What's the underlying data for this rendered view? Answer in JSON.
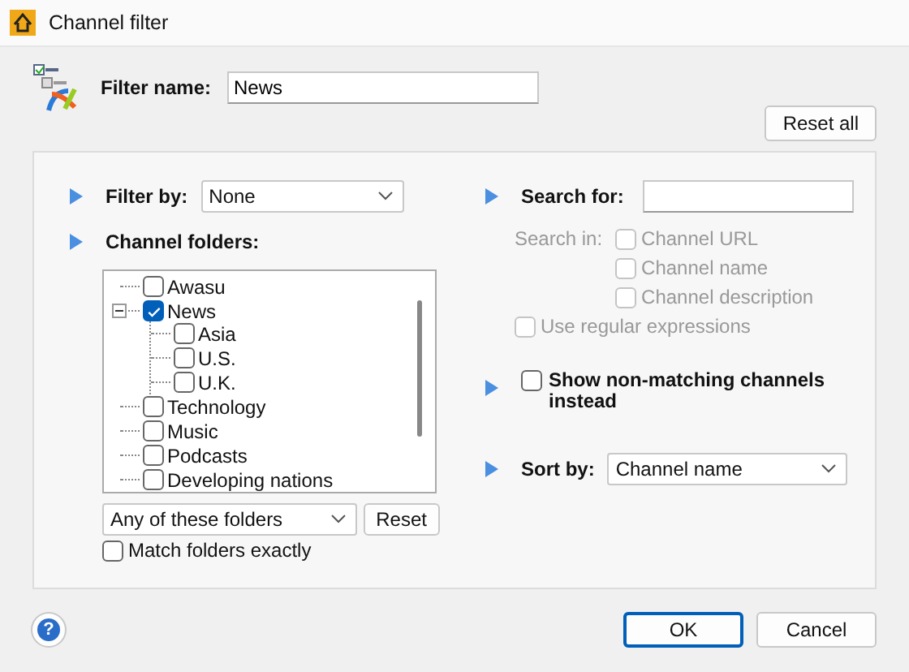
{
  "window": {
    "title": "Channel filter"
  },
  "filter_name": {
    "label": "Filter name:",
    "value": "News"
  },
  "reset_all_button": "Reset all",
  "filter_by": {
    "label": "Filter by:",
    "value": "None"
  },
  "channel_folders": {
    "label": "Channel folders:",
    "tree": [
      {
        "label": "Awasu",
        "checked": false
      },
      {
        "label": "News",
        "checked": true,
        "expanded": true,
        "children": [
          {
            "label": "Asia",
            "checked": false
          },
          {
            "label": "U.S.",
            "checked": false
          },
          {
            "label": "U.K.",
            "checked": false
          }
        ]
      },
      {
        "label": "Technology",
        "checked": false
      },
      {
        "label": "Music",
        "checked": false
      },
      {
        "label": "Podcasts",
        "checked": false
      },
      {
        "label": "Developing nations",
        "checked": false
      }
    ],
    "match_mode": "Any of these folders",
    "reset_button": "Reset",
    "match_exactly": {
      "label": "Match folders exactly",
      "checked": false
    }
  },
  "search": {
    "label": "Search for:",
    "search_in_label": "Search in:",
    "options": [
      {
        "label": "Channel URL",
        "checked": false,
        "disabled": true
      },
      {
        "label": "Channel name",
        "checked": false,
        "disabled": true
      },
      {
        "label": "Channel description",
        "checked": false,
        "disabled": true
      }
    ],
    "regex": {
      "label": "Use regular expressions",
      "checked": false,
      "disabled": true
    }
  },
  "show_non_matching": {
    "label": "Show non-matching channels instead",
    "checked": false
  },
  "sort_by": {
    "label": "Sort by:",
    "value": "Channel name"
  },
  "help_button": "?",
  "buttons": [
    {
      "label": "OK",
      "default": true
    },
    {
      "label": "Cancel",
      "default": false
    }
  ]
}
